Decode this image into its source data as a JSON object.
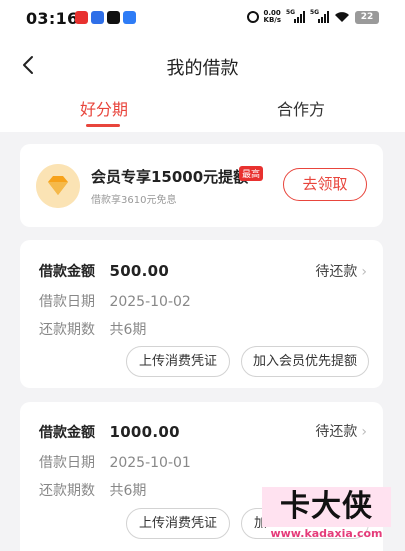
{
  "status_bar": {
    "time": "03:16",
    "net_speed_value": "0.00",
    "net_speed_unit": "KB/s",
    "signal_1_label": "5G",
    "signal_2_label": "5G",
    "battery_level": "22"
  },
  "header": {
    "title": "我的借款",
    "back_icon": "chevron-left-icon"
  },
  "tabs": [
    {
      "label": "好分期",
      "active": true
    },
    {
      "label": "合作方",
      "active": false
    }
  ],
  "promo": {
    "title": "会员专享15000元提额",
    "badge": "最高",
    "subtitle": "借款享3610元免息",
    "button_label": "去领取",
    "icon": "diamond-icon"
  },
  "loans": [
    {
      "amount_label": "借款金额",
      "amount": "500.00",
      "status": "待还款",
      "date_label": "借款日期",
      "date": "2025-10-02",
      "periods_label": "还款期数",
      "periods": "共6期",
      "upload_label": "上传消费凭证",
      "join_label": "加入会员优先提额"
    },
    {
      "amount_label": "借款金额",
      "amount": "1000.00",
      "status": "待还款",
      "date_label": "借款日期",
      "date": "2025-10-01",
      "periods_label": "还款期数",
      "periods": "共6期",
      "upload_label": "上传消费凭证",
      "join_label": "加"
    }
  ],
  "watermark": {
    "title": "卡大侠",
    "url": "www.kadaxia.com"
  },
  "colors": {
    "accent": "#e8453c",
    "background": "#f3f3f5"
  }
}
